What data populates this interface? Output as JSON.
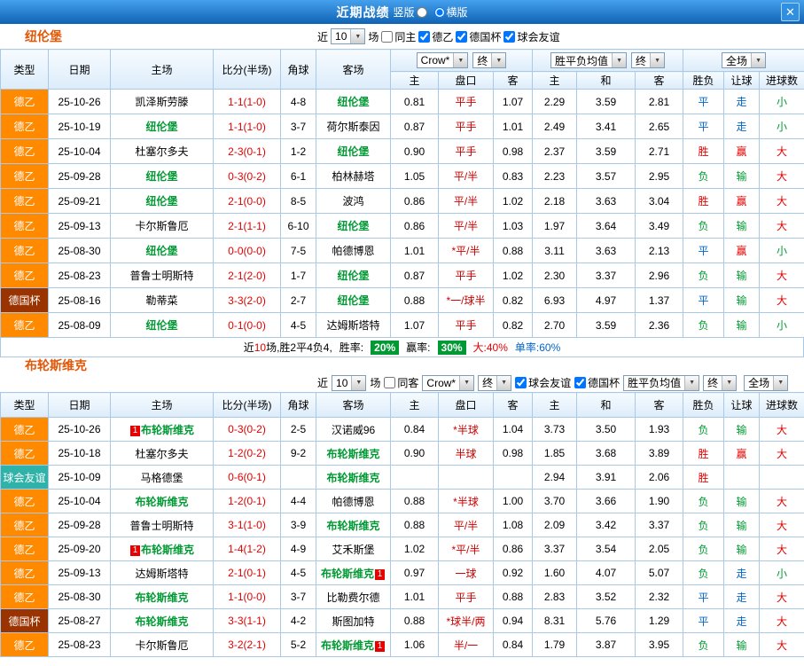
{
  "titlebar": {
    "title": "近期战绩",
    "layout_options": [
      {
        "label": "竖版",
        "checked": false
      },
      {
        "label": "横版",
        "checked": true
      }
    ],
    "close_icon": "✕"
  },
  "dropdowns": {
    "odds_source": "Crow*",
    "final1": "终",
    "avg": "胜平负均值",
    "final2": "终",
    "scope": "全场"
  },
  "table_columns": {
    "type": "类型",
    "date": "日期",
    "home": "主场",
    "score": "比分(半场)",
    "corner": "角球",
    "away": "客场",
    "odds_home": "主",
    "odds_line": "盘口",
    "odds_away": "客",
    "avg_home": "主",
    "avg_draw": "和",
    "avg_away": "客",
    "res_wdl": "胜负",
    "res_handicap": "让球",
    "res_goals": "进球数"
  },
  "colors": {
    "league_de2": "#ff8a00",
    "league_cup": "#993300",
    "league_friendly": "#2fb3a9",
    "win_red": "#e60000",
    "draw_blue": "#0066cc",
    "lose_green": "#009933",
    "team_accent": "#e25606",
    "titlebar_blue": "#1063b4"
  },
  "sections": [
    {
      "team": "纽伦堡",
      "filter": {
        "near": "近",
        "count": "10",
        "games": "场",
        "checkboxes": [
          {
            "label": "同主",
            "checked": false
          },
          {
            "label": "德乙",
            "checked": true
          },
          {
            "label": "德国杯",
            "checked": true
          },
          {
            "label": "球会友谊",
            "checked": true
          }
        ]
      },
      "rows": [
        {
          "league": "德乙",
          "date": "25-10-26",
          "home": "凯泽斯劳滕",
          "home_focus": false,
          "away": "纽伦堡",
          "away_focus": true,
          "score": "1-1(1-0)",
          "corner": "4-8",
          "odds": [
            "0.81",
            "平手",
            "1.07"
          ],
          "avg": [
            "2.29",
            "3.59",
            "2.81"
          ],
          "results": [
            "平",
            "走",
            "小"
          ]
        },
        {
          "league": "德乙",
          "date": "25-10-19",
          "home": "纽伦堡",
          "home_focus": true,
          "away": "荷尔斯泰因",
          "away_focus": false,
          "score": "1-1(1-0)",
          "corner": "3-7",
          "odds": [
            "0.87",
            "平手",
            "1.01"
          ],
          "avg": [
            "2.49",
            "3.41",
            "2.65"
          ],
          "results": [
            "平",
            "走",
            "小"
          ]
        },
        {
          "league": "德乙",
          "date": "25-10-04",
          "home": "杜塞尔多夫",
          "home_focus": false,
          "away": "纽伦堡",
          "away_focus": true,
          "score": "2-3(0-1)",
          "corner": "1-2",
          "odds": [
            "0.90",
            "平手",
            "0.98"
          ],
          "avg": [
            "2.37",
            "3.59",
            "2.71"
          ],
          "results": [
            "胜",
            "赢",
            "大"
          ]
        },
        {
          "league": "德乙",
          "date": "25-09-28",
          "home": "纽伦堡",
          "home_focus": true,
          "away": "柏林赫塔",
          "away_focus": false,
          "score": "0-3(0-2)",
          "corner": "6-1",
          "odds": [
            "1.05",
            "平/半",
            "0.83"
          ],
          "avg": [
            "2.23",
            "3.57",
            "2.95"
          ],
          "results": [
            "负",
            "输",
            "大"
          ]
        },
        {
          "league": "德乙",
          "date": "25-09-21",
          "home": "纽伦堡",
          "home_focus": true,
          "away": "波鸿",
          "away_focus": false,
          "score": "2-1(0-0)",
          "corner": "8-5",
          "odds": [
            "0.86",
            "平/半",
            "1.02"
          ],
          "avg": [
            "2.18",
            "3.63",
            "3.04"
          ],
          "results": [
            "胜",
            "赢",
            "大"
          ]
        },
        {
          "league": "德乙",
          "date": "25-09-13",
          "home": "卡尔斯鲁厄",
          "home_focus": false,
          "away": "纽伦堡",
          "away_focus": true,
          "score": "2-1(1-1)",
          "corner": "6-10",
          "odds": [
            "0.86",
            "平/半",
            "1.03"
          ],
          "avg": [
            "1.97",
            "3.64",
            "3.49"
          ],
          "results": [
            "负",
            "输",
            "大"
          ]
        },
        {
          "league": "德乙",
          "date": "25-08-30",
          "home": "纽伦堡",
          "home_focus": true,
          "away": "帕德博恩",
          "away_focus": false,
          "score": "0-0(0-0)",
          "corner": "7-5",
          "odds": [
            "1.01",
            "*平/半",
            "0.88"
          ],
          "avg": [
            "3.11",
            "3.63",
            "2.13"
          ],
          "results": [
            "平",
            "赢",
            "小"
          ]
        },
        {
          "league": "德乙",
          "date": "25-08-23",
          "home": "普鲁士明斯特",
          "home_focus": false,
          "away": "纽伦堡",
          "away_focus": true,
          "score": "2-1(2-0)",
          "corner": "1-7",
          "odds": [
            "0.87",
            "平手",
            "1.02"
          ],
          "avg": [
            "2.30",
            "3.37",
            "2.96"
          ],
          "results": [
            "负",
            "输",
            "大"
          ]
        },
        {
          "league": "德国杯",
          "date": "25-08-16",
          "home": "勒蒂菜",
          "home_focus": false,
          "away": "纽伦堡",
          "away_focus": true,
          "score": "3-3(2-0)",
          "corner": "2-7",
          "odds": [
            "0.88",
            "*一/球半",
            "0.82"
          ],
          "avg": [
            "6.93",
            "4.97",
            "1.37"
          ],
          "results": [
            "平",
            "输",
            "大"
          ]
        },
        {
          "league": "德乙",
          "date": "25-08-09",
          "home": "纽伦堡",
          "home_focus": true,
          "away": "达姆斯塔特",
          "away_focus": false,
          "score": "0-1(0-0)",
          "corner": "4-5",
          "odds": [
            "1.07",
            "平手",
            "0.82"
          ],
          "avg": [
            "2.70",
            "3.59",
            "2.36"
          ],
          "results": [
            "负",
            "输",
            "小"
          ]
        }
      ],
      "summary": {
        "prefix": "近",
        "count": "10",
        "tail": "场,胜2平4负4,",
        "win_rate_label": "胜率:",
        "win_rate": "20%",
        "handicap_rate_label": "赢率:",
        "handicap_rate": "30%",
        "big_rate": "大:40%",
        "single_rate": "单率:60%"
      }
    },
    {
      "team": "布轮斯维克",
      "filter": {
        "near": "近",
        "count": "10",
        "games": "场",
        "checkbox_same": {
          "label": "同客",
          "checked": false
        },
        "checkboxes": [
          {
            "label": "球会友谊",
            "checked": true
          },
          {
            "label": "德国杯",
            "checked": true
          }
        ]
      },
      "rows": [
        {
          "league": "德乙",
          "date": "25-10-26",
          "home": "布轮斯维克",
          "home_focus": true,
          "home_badge": "1",
          "away": "汉诺威96",
          "away_focus": false,
          "score": "0-3(0-2)",
          "corner": "2-5",
          "odds": [
            "0.84",
            "*半球",
            "1.04"
          ],
          "avg": [
            "3.73",
            "3.50",
            "1.93"
          ],
          "results": [
            "负",
            "输",
            "大"
          ]
        },
        {
          "league": "德乙",
          "date": "25-10-18",
          "home": "杜塞尔多夫",
          "home_focus": false,
          "away": "布轮斯维克",
          "away_focus": true,
          "score": "1-2(0-2)",
          "corner": "9-2",
          "odds": [
            "0.90",
            "半球",
            "0.98"
          ],
          "avg": [
            "1.85",
            "3.68",
            "3.89"
          ],
          "results": [
            "胜",
            "赢",
            "大"
          ]
        },
        {
          "league": "球会友谊",
          "date": "25-10-09",
          "home": "马格德堡",
          "home_focus": false,
          "away": "布轮斯维克",
          "away_focus": true,
          "score": "0-6(0-1)",
          "corner": "",
          "odds": [
            "",
            "",
            ""
          ],
          "avg": [
            "2.94",
            "3.91",
            "2.06"
          ],
          "results": [
            "胜",
            "",
            ""
          ]
        },
        {
          "league": "德乙",
          "date": "25-10-04",
          "home": "布轮斯维克",
          "home_focus": true,
          "away": "帕德博恩",
          "away_focus": false,
          "score": "1-2(0-1)",
          "corner": "4-4",
          "odds": [
            "0.88",
            "*半球",
            "1.00"
          ],
          "avg": [
            "3.70",
            "3.66",
            "1.90"
          ],
          "results": [
            "负",
            "输",
            "大"
          ]
        },
        {
          "league": "德乙",
          "date": "25-09-28",
          "home": "普鲁士明斯特",
          "home_focus": false,
          "away": "布轮斯维克",
          "away_focus": true,
          "score": "3-1(1-0)",
          "corner": "3-9",
          "odds": [
            "0.88",
            "平/半",
            "1.08"
          ],
          "avg": [
            "2.09",
            "3.42",
            "3.37"
          ],
          "results": [
            "负",
            "输",
            "大"
          ]
        },
        {
          "league": "德乙",
          "date": "25-09-20",
          "home": "布轮斯维克",
          "home_focus": true,
          "home_badge": "1",
          "away": "艾禾斯堡",
          "away_focus": false,
          "score": "1-4(1-2)",
          "corner": "4-9",
          "odds": [
            "1.02",
            "*平/半",
            "0.86"
          ],
          "avg": [
            "3.37",
            "3.54",
            "2.05"
          ],
          "results": [
            "负",
            "输",
            "大"
          ]
        },
        {
          "league": "德乙",
          "date": "25-09-13",
          "home": "达姆斯塔特",
          "home_focus": false,
          "away": "布轮斯维克",
          "away_focus": true,
          "away_badge": "1",
          "score": "2-1(0-1)",
          "corner": "4-5",
          "odds": [
            "0.97",
            "一球",
            "0.92"
          ],
          "avg": [
            "1.60",
            "4.07",
            "5.07"
          ],
          "results": [
            "负",
            "走",
            "小"
          ]
        },
        {
          "league": "德乙",
          "date": "25-08-30",
          "home": "布轮斯维克",
          "home_focus": true,
          "away": "比勒费尔德",
          "away_focus": false,
          "score": "1-1(0-0)",
          "corner": "3-7",
          "odds": [
            "1.01",
            "平手",
            "0.88"
          ],
          "avg": [
            "2.83",
            "3.52",
            "2.32"
          ],
          "results": [
            "平",
            "走",
            "大"
          ]
        },
        {
          "league": "德国杯",
          "date": "25-08-27",
          "home": "布轮斯维克",
          "home_focus": true,
          "away": "斯图加特",
          "away_focus": false,
          "score": "3-3(1-1)",
          "corner": "4-2",
          "odds": [
            "0.88",
            "*球半/两",
            "0.94"
          ],
          "avg": [
            "8.31",
            "5.76",
            "1.29"
          ],
          "results": [
            "平",
            "走",
            "大"
          ]
        },
        {
          "league": "德乙",
          "date": "25-08-23",
          "home": "卡尔斯鲁厄",
          "home_focus": false,
          "away": "布轮斯维克",
          "away_focus": true,
          "away_badge": "1",
          "score": "3-2(2-1)",
          "corner": "5-2",
          "odds": [
            "1.06",
            "半/一",
            "0.84"
          ],
          "avg": [
            "1.79",
            "3.87",
            "3.95"
          ],
          "results": [
            "负",
            "输",
            "大"
          ]
        }
      ]
    }
  ]
}
